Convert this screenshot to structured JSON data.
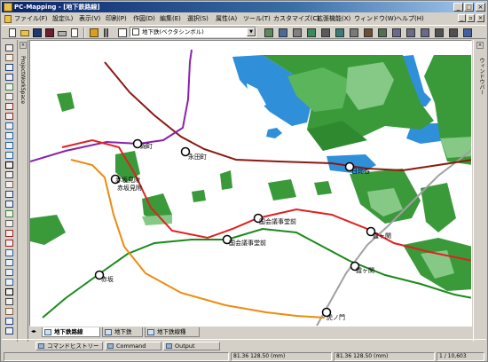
{
  "window": {
    "title": "PC-Mapping - [地下鉄路線]",
    "min": "_",
    "max": "□",
    "close": "×"
  },
  "menu": [
    "ファイル(F)",
    "設定(L)",
    "表示(V)",
    "印刷(P)",
    "作図(D)",
    "編集(E)",
    "選択(S)",
    "属性(A)",
    "ツール(T)",
    "カスタマイズ(C)",
    "拡張機能(X)",
    "ウィンドウ(W)",
    "ヘルプ(H)"
  ],
  "toolbar": {
    "layer_select": "地下鉄(ベクタシンボル)"
  },
  "side_panels": {
    "left": "ProjectWorkSpace",
    "right": "ウィンドウバー"
  },
  "map": {
    "stations": [
      "国会議事堂前",
      "国会議事堂前",
      "赤坂見附",
      "赤坂見附",
      "霞ヶ関",
      "霞ヶ関",
      "赤坂",
      "虎ノ門",
      "日比谷",
      "麹町",
      "永田町"
    ],
    "station_labels": {
      "kojimachi": "麹町",
      "nagatacho_top": "永田町",
      "hibiya": "日比谷",
      "akasakamitsuke_1": "赤坂見附",
      "akasakamitsuke_2": "赤坂見附",
      "kokkai_1": "国会議事堂前",
      "kokkai_2": "国会議事堂前",
      "kasumigaseki_1": "霞ヶ関",
      "kasumigaseki_2": "霞ヶ関",
      "akasaka": "赤坂",
      "toranomon": "虎ノ門"
    },
    "colors": {
      "water": "#2f8fd8",
      "greenery": "#3a9a3a",
      "line_marunouchi": "#e02020",
      "line_chiyoda": "#1a8a1a",
      "line_ginza": "#ee8a10",
      "line_tozai_dark": "#8a1a10",
      "line_hanzomon": "#8a22aa",
      "line_hibiya": "#a0a0a0"
    }
  },
  "tabs": [
    "地下鉄路線",
    "地下鉄",
    "地下鉄線種"
  ],
  "bottom_tabs": [
    "コマンドヒストリー",
    "Command",
    "Output"
  ],
  "status": {
    "coord1": "81.36 128.50 (mm)",
    "coord2": "81.36 128.50 (mm)",
    "scale": "1 / 10,603"
  }
}
